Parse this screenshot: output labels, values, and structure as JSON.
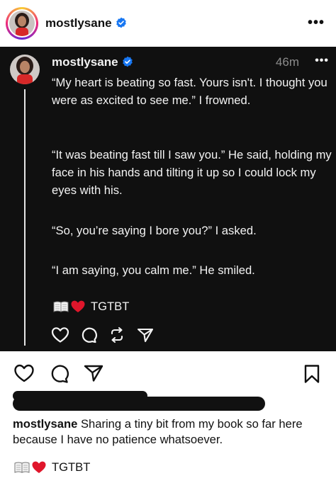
{
  "header": {
    "username": "mostlysane",
    "more_label": "•••"
  },
  "threads_post": {
    "username": "mostlysane",
    "time": "46m",
    "more_label": "•••",
    "paragraphs": [
      "“My heart is beating so fast. Yours isn't. I thought you were as excited to see me.” I frowned.",
      "“It was beating fast till I saw you.” He said, holding my face in his hands and tilting it up so I could lock my eyes with his.",
      "“So, you’re saying I bore you?” I asked.",
      "“I am saying, you calm me.” He smiled."
    ],
    "tag": "TGTBT",
    "actions": [
      "heart-icon",
      "comment-icon",
      "repost-icon",
      "share-icon"
    ]
  },
  "post_actions": [
    "heart-icon",
    "comment-icon",
    "share-icon",
    "bookmark-icon"
  ],
  "caption": {
    "username": "mostlysane",
    "text": "Sharing a tiny bit from my book so far here because I have no patience whatsoever.",
    "tag": "TGTBT"
  },
  "colors": {
    "card_bg": "#101010",
    "verified": "#1877f2",
    "heart": "#e0162b"
  }
}
